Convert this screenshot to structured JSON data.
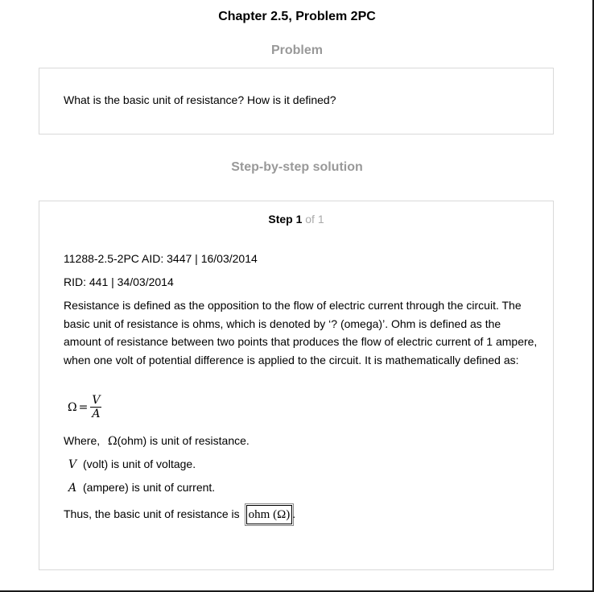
{
  "header": {
    "chapter_title": "Chapter 2.5, Problem 2PC"
  },
  "problem": {
    "heading": "Problem",
    "text": "What is the basic unit of resistance? How is it defined?"
  },
  "solution": {
    "heading": "Step-by-step solution",
    "step": {
      "label": "Step 1",
      "of_text": "of 1"
    },
    "meta_line_1": "11288-2.5-2PC AID: 3447 | 16/03/2014",
    "meta_line_2": "RID: 441 | 34/03/2014",
    "paragraph": "Resistance is defined as the opposition to the flow of electric current through the circuit. The basic unit of resistance is ohms, which is denoted by ‘? (omega)’. Ohm is defined as the amount of resistance between two points that produces the flow of electric current of 1 ampere, when one volt of potential difference is applied to the circuit. It is mathematically defined as:",
    "formula": {
      "lhs": "Ω",
      "equals": "=",
      "numerator": "V",
      "denominator": "A"
    },
    "where_prefix": "Where,",
    "ohm_symbol": "Ω",
    "ohm_desc": "(ohm) is unit of resistance.",
    "volt_symbol": "V",
    "volt_desc": "(volt) is unit of voltage.",
    "ampere_symbol": "A",
    "ampere_desc": "(ampere) is unit of current.",
    "conclusion_prefix": "Thus, the basic unit of resistance is",
    "answer": "ohm (Ω)",
    "conclusion_suffix": "."
  }
}
